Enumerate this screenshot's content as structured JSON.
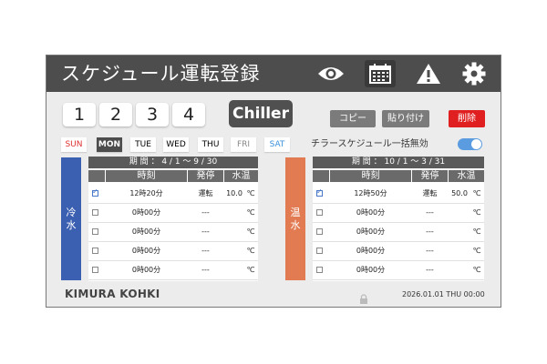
{
  "header": {
    "title": "スケジュール運転登録",
    "icons": [
      "eye-icon",
      "calendar-icon",
      "warning-icon",
      "gear-icon"
    ]
  },
  "schedule_numbers": [
    "1",
    "2",
    "3",
    "4"
  ],
  "chiller_button": "Chiller",
  "actions": {
    "copy": "コピー",
    "paste": "貼り付け",
    "delete": "削除"
  },
  "days": [
    "SUN",
    "MON",
    "TUE",
    "WED",
    "THU",
    "FRI",
    "SAT"
  ],
  "selected_day": "MON",
  "toggle": {
    "label": "チラースケジュール一括無効",
    "on": true
  },
  "columns": {
    "time": "時刻",
    "state": "発停",
    "temp": "水温"
  },
  "cooling": {
    "side_label": [
      "冷",
      "水"
    ],
    "period": "期 間 ： 4 / 1 〜 9 / 30",
    "rows": [
      {
        "checked": true,
        "time": "12時20分",
        "state": "運転",
        "temp": "10.0",
        "unit": "℃"
      },
      {
        "checked": false,
        "time": "0時00分",
        "state": "---",
        "temp": "",
        "unit": "℃"
      },
      {
        "checked": false,
        "time": "0時00分",
        "state": "---",
        "temp": "",
        "unit": "℃"
      },
      {
        "checked": false,
        "time": "0時00分",
        "state": "---",
        "temp": "",
        "unit": "℃"
      },
      {
        "checked": false,
        "time": "0時00分",
        "state": "---",
        "temp": "",
        "unit": "℃"
      }
    ]
  },
  "heating": {
    "side_label": [
      "温",
      "水"
    ],
    "period": "期 間 ： 10 / 1 〜 3 / 31",
    "rows": [
      {
        "checked": true,
        "time": "12時50分",
        "state": "運転",
        "temp": "50.0",
        "unit": "℃"
      },
      {
        "checked": false,
        "time": "0時00分",
        "state": "---",
        "temp": "",
        "unit": "℃"
      },
      {
        "checked": false,
        "time": "0時00分",
        "state": "---",
        "temp": "",
        "unit": "℃"
      },
      {
        "checked": false,
        "time": "0時00分",
        "state": "---",
        "temp": "",
        "unit": "℃"
      },
      {
        "checked": false,
        "time": "0時00分",
        "state": "---",
        "temp": "",
        "unit": "℃"
      }
    ]
  },
  "footer": {
    "logo": "KIMURA KOHKI",
    "datetime": "2026.01.01 THU 00:00"
  },
  "colors": {
    "header_bg": "#4d4d4d",
    "cooling": "#3b5fb1",
    "heating": "#e27b52",
    "delete": "#e02020",
    "sun": "#e03030",
    "sat": "#3a8fd8",
    "toggle": "#5b9be0"
  }
}
